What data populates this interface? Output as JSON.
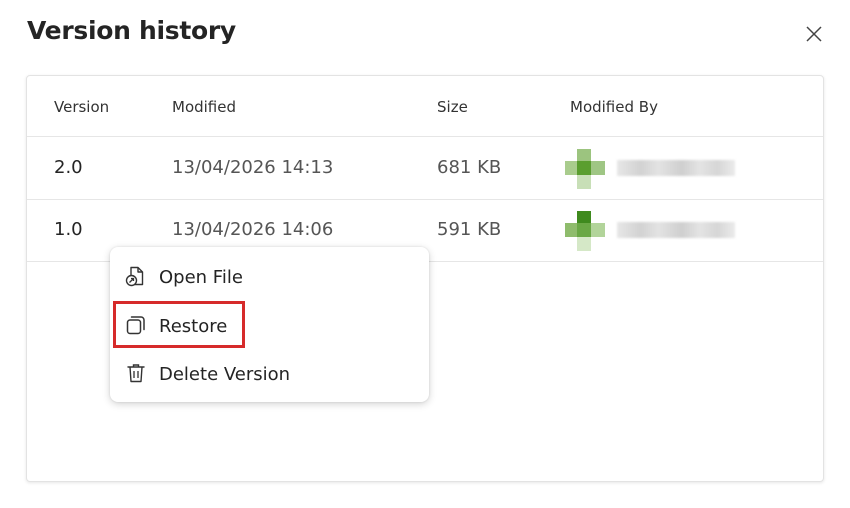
{
  "dialog": {
    "title": "Version history",
    "close_icon": "close-icon"
  },
  "table": {
    "columns": [
      "Version",
      "Modified",
      "Size",
      "Modified By"
    ],
    "rows": [
      {
        "version": "2.0",
        "modified": "13/04/2026 14:13",
        "size": "681 KB",
        "modified_by": ""
      },
      {
        "version": "1.0",
        "modified": "13/04/2026 14:06",
        "size": "591 KB",
        "modified_by": ""
      }
    ]
  },
  "context_menu": {
    "items": [
      {
        "label": "Open File",
        "icon": "open-file-icon"
      },
      {
        "label": "Restore",
        "icon": "restore-icon"
      },
      {
        "label": "Delete Version",
        "icon": "trash-icon"
      }
    ]
  },
  "colors": {
    "highlight": "#d62a2a",
    "avatar_green": "#5a9e2f"
  }
}
